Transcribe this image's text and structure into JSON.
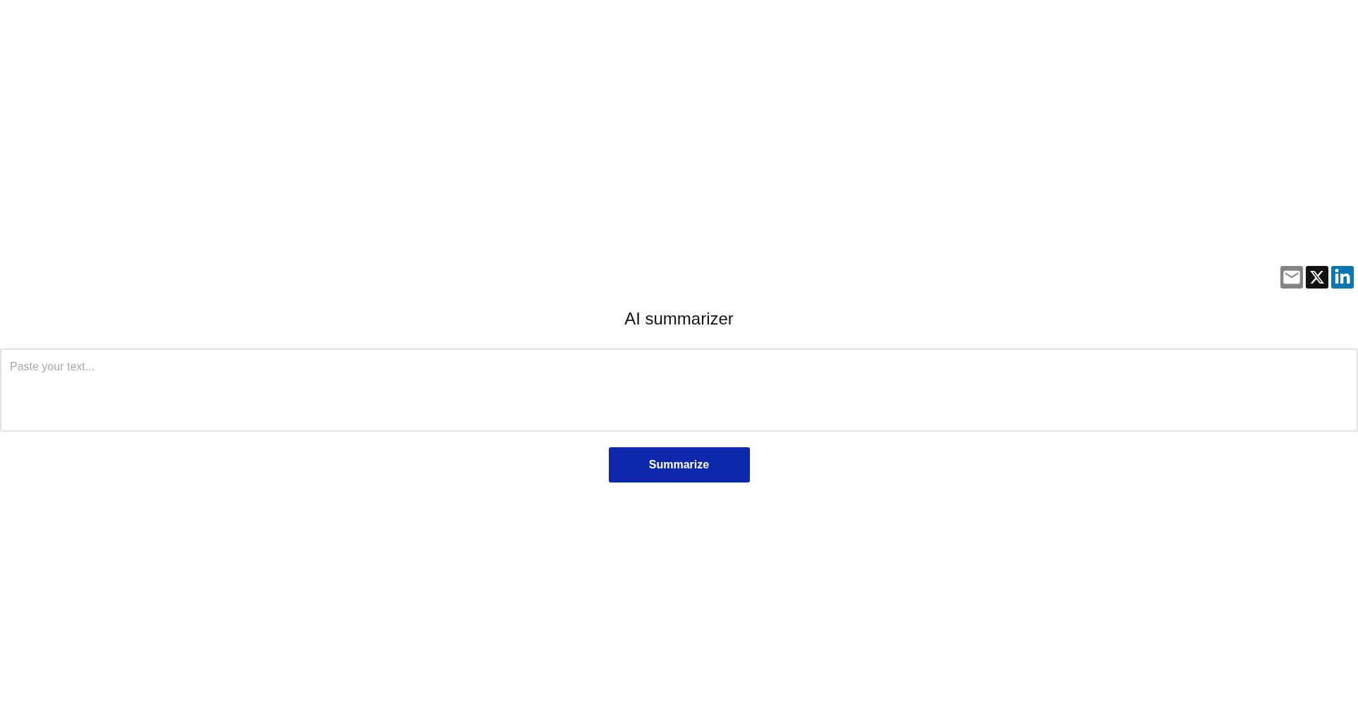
{
  "share_buttons": [
    {
      "kind": "email"
    },
    {
      "kind": "x"
    },
    {
      "kind": "linkedin"
    }
  ],
  "title": "AI summarizer",
  "text_field": {
    "placeholder": "Paste your text..."
  },
  "submit_button": {
    "label": "Summarize"
  }
}
